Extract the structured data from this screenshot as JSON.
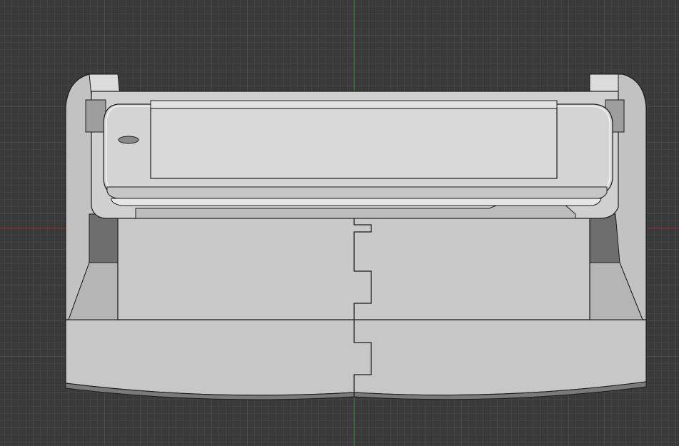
{
  "viewport": {
    "background": "#3a3a3a",
    "grid_minor_color": "#434343",
    "grid_major_color": "#4a4a4a",
    "axis_x_color": "#9c2a2a",
    "axis_y_color": "#2f7a3a"
  },
  "model": {
    "body_color": "#c4c4c4",
    "body_shadow_color": "#a9a9a9",
    "dark_color": "#6e6e6e",
    "edge_color": "#1c1c1c",
    "device_color": "#d4d4d4",
    "device_highlight": "#f4f4f4",
    "screen_color": "#d9d9d9"
  }
}
